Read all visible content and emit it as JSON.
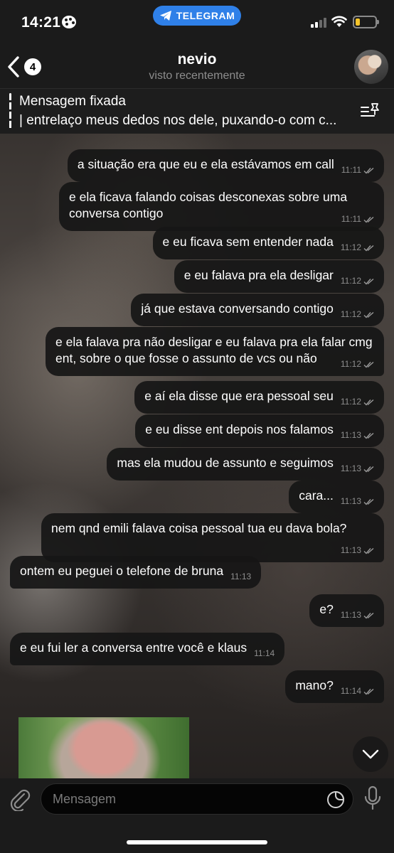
{
  "status_bar": {
    "time": "14:21",
    "app_pill": "TELEGRAM",
    "palette_icon": "palette-icon",
    "battery_color": "#f7c52a"
  },
  "header": {
    "back_count": "4",
    "name": "nevio",
    "status": "visto recentemente"
  },
  "pinned": {
    "title": "Mensagem fixada",
    "text": "| entrelaço meus dedos nos dele, puxando-o com c..."
  },
  "messages": [
    {
      "dir": "out",
      "text": "a situação era que eu e ela estávamos em call",
      "time": "11:11"
    },
    {
      "dir": "out",
      "text": "e ela ficava falando coisas desconexas sobre uma conversa contigo",
      "time": "11:11"
    },
    {
      "dir": "out",
      "text": "e eu ficava sem entender nada",
      "time": "11:12"
    },
    {
      "dir": "out",
      "text": "e eu falava pra ela desligar",
      "time": "11:12"
    },
    {
      "dir": "out",
      "text": "já que estava conversando contigo",
      "time": "11:12"
    },
    {
      "dir": "out",
      "text": "e ela falava pra não desligar e eu falava pra ela falar cmg ent, sobre o que fosse o assunto de vcs ou não",
      "time": "11:12"
    },
    {
      "dir": "out",
      "text": "e aí ela disse que era pessoal seu",
      "time": "11:12"
    },
    {
      "dir": "out",
      "text": "e eu disse ent depois nos falamos",
      "time": "11:13"
    },
    {
      "dir": "out",
      "text": "mas ela mudou de assunto e seguimos",
      "time": "11:13"
    },
    {
      "dir": "out",
      "text": "cara...",
      "time": "11:13"
    },
    {
      "dir": "out",
      "text": "nem qnd emili falava coisa pessoal tua eu dava bola?",
      "time": "11:13"
    },
    {
      "dir": "in",
      "text": "ontem eu peguei o telefone de bruna",
      "time": "11:13"
    },
    {
      "dir": "out",
      "text": "e?",
      "time": "11:13"
    },
    {
      "dir": "in",
      "text": "e eu fui ler a conversa entre você e klaus",
      "time": "11:14"
    },
    {
      "dir": "out",
      "text": "mano?",
      "time": "11:14"
    }
  ],
  "input": {
    "placeholder": "Mensagem"
  },
  "colors": {
    "accent": "#2f80e8",
    "bubble": "#161616",
    "bar": "#1b1b1b"
  }
}
